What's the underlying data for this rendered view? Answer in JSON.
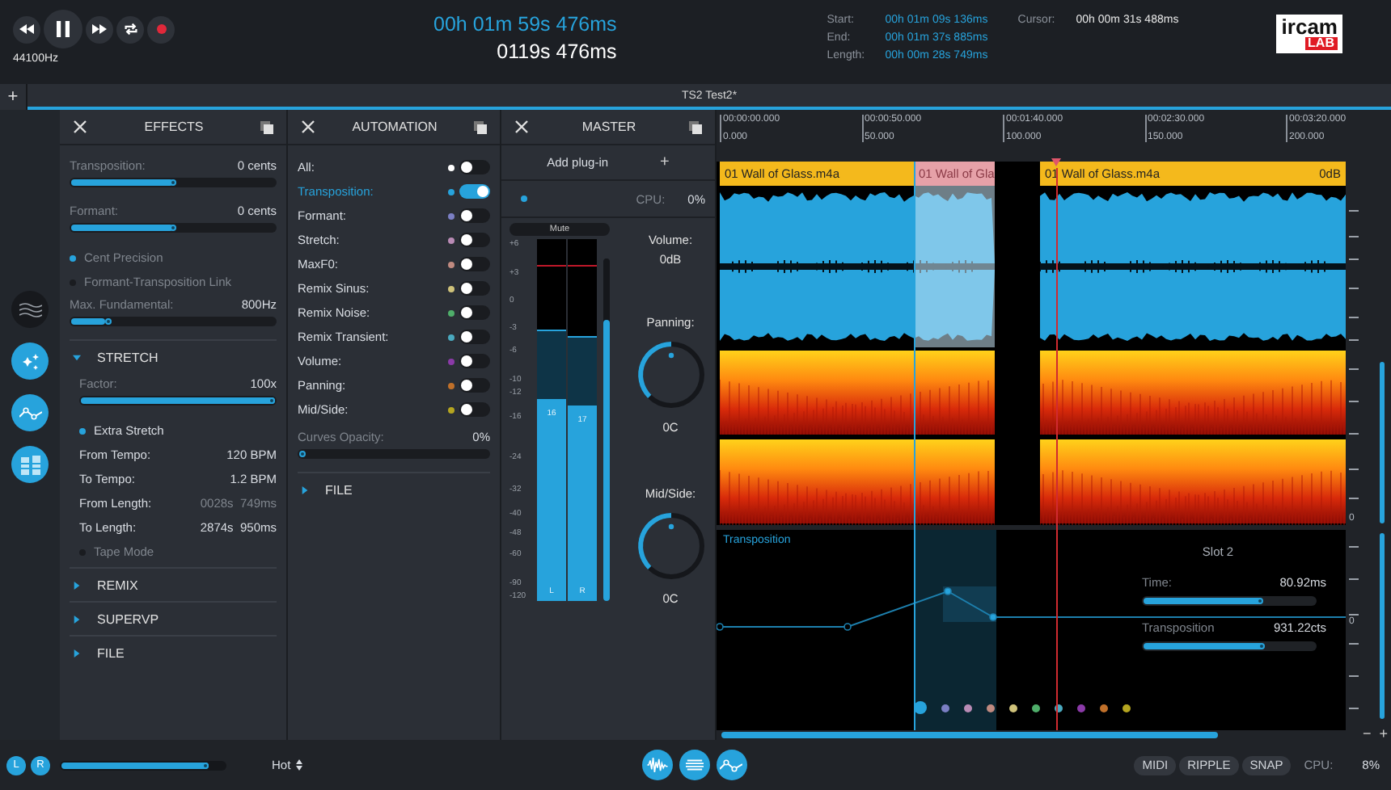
{
  "transport": {
    "buttons": [
      {
        "kind": "rewind"
      },
      {
        "kind": "pause"
      },
      {
        "kind": "forward"
      },
      {
        "kind": "loop"
      },
      {
        "kind": "record"
      }
    ],
    "sample_rate": "44100Hz"
  },
  "clock": {
    "time": "00h 01m 59s 476ms",
    "seconds": "0119s 476ms"
  },
  "selection": [
    {
      "label": "Start:",
      "value": "00h 01m 09s 136ms"
    },
    {
      "label": "End:",
      "value": "00h 01m 37s 885ms"
    },
    {
      "label": "Length:",
      "value": "00h 00m 28s 749ms"
    }
  ],
  "cursor": {
    "label": "Cursor:",
    "value": "00h 00m 31s 488ms"
  },
  "logo": {
    "top": "ircam",
    "bottom": "LAB"
  },
  "add_tab": "+",
  "tabs": [
    {
      "title": "TS2 Test2*",
      "selected": true
    }
  ],
  "rail": [
    {
      "kind": "waves",
      "selected": false
    },
    {
      "kind": "sparkle",
      "selected": true
    },
    {
      "kind": "curve",
      "selected": true
    },
    {
      "kind": "bars",
      "selected": true
    }
  ],
  "effects": {
    "title": "EFFECTS",
    "rows": [
      {
        "kind": "slider",
        "label": "Transposition:",
        "value": "0 cents",
        "level": 0.5
      },
      {
        "kind": "slider",
        "label": "Formant:",
        "value": "0 cents",
        "level": 0.5
      },
      {
        "kind": "option",
        "label": "Cent Precision",
        "checked": true,
        "disabled": true
      },
      {
        "kind": "option",
        "label": "Formant-Transposition Link",
        "checked": false,
        "disabled": true
      },
      {
        "kind": "slider",
        "label": "Max. Fundamental:",
        "value": "800Hz",
        "level": 0.17
      }
    ],
    "sections": [
      {
        "title": "STRETCH",
        "expanded": true,
        "rows": [
          {
            "kind": "slider",
            "label": "Factor:",
            "value": "100x",
            "level": 1
          },
          {
            "kind": "option",
            "label": "Extra Stretch",
            "checked": true,
            "disabled": false
          },
          {
            "kind": "pair",
            "label": "From Tempo:",
            "value": "120 BPM",
            "disabled": false
          },
          {
            "kind": "pair",
            "label": "To Tempo:",
            "value": "1.2 BPM",
            "disabled": false
          },
          {
            "kind": "pair",
            "label": "From Length:",
            "value": "0028s  749ms",
            "disabled": true
          },
          {
            "kind": "pair",
            "label": "To Length:",
            "value": "2874s  950ms",
            "disabled": false
          },
          {
            "kind": "option",
            "label": "Tape Mode",
            "checked": false,
            "disabled": true
          }
        ]
      },
      {
        "title": "REMIX",
        "expanded": false
      },
      {
        "title": "SUPERVP",
        "expanded": false
      },
      {
        "title": "FILE",
        "expanded": false
      }
    ]
  },
  "automation": {
    "title": "AUTOMATION",
    "items": [
      {
        "label": "All:",
        "color": "#ffffff",
        "on": false,
        "selected": false
      },
      {
        "label": "Transposition:",
        "color": "#27a3dc",
        "on": true,
        "selected": true
      },
      {
        "label": "Formant:",
        "color": "#7b7fc4",
        "on": false,
        "selected": false
      },
      {
        "label": "Stretch:",
        "color": "#b98bb5",
        "on": false,
        "selected": false
      },
      {
        "label": "MaxF0:",
        "color": "#c08a80",
        "on": false,
        "selected": false
      },
      {
        "label": "Remix Sinus:",
        "color": "#cfc27a",
        "on": false,
        "selected": false
      },
      {
        "label": "Remix Noise:",
        "color": "#4fae6a",
        "on": false,
        "selected": false
      },
      {
        "label": "Remix Transient:",
        "color": "#4aa9bf",
        "on": false,
        "selected": false
      },
      {
        "label": "Volume:",
        "color": "#8b3aa8",
        "on": false,
        "selected": false
      },
      {
        "label": "Panning:",
        "color": "#c0702a",
        "on": false,
        "selected": false
      },
      {
        "label": "Mid/Side:",
        "color": "#b5a520",
        "on": false,
        "selected": false
      }
    ],
    "opacity": {
      "label": "Curves Opacity:",
      "value": "0%",
      "level": 0
    },
    "sections": [
      {
        "title": "FILE",
        "expanded": false
      }
    ]
  },
  "master": {
    "title": "MASTER",
    "add_plugin": "Add plug-in",
    "add_icon": "+",
    "cpu": {
      "label": "CPU:",
      "value": "0%"
    },
    "mute": "Mute",
    "scale": [
      "+6",
      "+3",
      "0",
      "-3",
      "-6",
      "-10",
      "-12",
      "-16",
      "-24",
      "-32",
      "-40",
      "-48",
      "-60",
      "-90",
      "-120"
    ],
    "channels": [
      {
        "name": "L",
        "reading": "16",
        "level": 0.56
      },
      {
        "name": "R",
        "reading": "17",
        "level": 0.54
      }
    ],
    "fader": {
      "level": 0.82
    },
    "volume": {
      "label": "Volume:",
      "value": "0dB"
    },
    "knobs": [
      {
        "label": "Panning:",
        "value": "0C"
      },
      {
        "label": "Mid/Side:",
        "value": "0C"
      }
    ]
  },
  "editor": {
    "ruler": [
      {
        "time": "00:00:00.000",
        "seconds": "0.000"
      },
      {
        "time": "00:00:50.000",
        "seconds": "50.000"
      },
      {
        "time": "00:01:40.000",
        "seconds": "100.000"
      },
      {
        "time": "00:02:30.000",
        "seconds": "150.000"
      },
      {
        "time": "00:03:20.000",
        "seconds": "200.000"
      }
    ],
    "clips": [
      {
        "kind": "clip",
        "name": "01 Wall of Glass.m4a"
      },
      {
        "kind": "ghost",
        "name": "01 Wall of Gla"
      },
      {
        "kind": "clip",
        "name": "01 Wall of Glass.m4a",
        "gain": "0dB"
      }
    ],
    "lane": {
      "title": "Transposition",
      "slot": "Slot 2",
      "params": [
        {
          "label": "Time:",
          "value": "80.92ms",
          "level": 0.69
        },
        {
          "label": "Transposition",
          "value": "931.22cts",
          "level": 0.7
        }
      ],
      "curves": [
        {
          "color": "#27a3dc",
          "selected": true
        },
        {
          "color": "#7b7fc4",
          "selected": false
        },
        {
          "color": "#b98bb5",
          "selected": false
        },
        {
          "color": "#c08a80",
          "selected": false
        },
        {
          "color": "#cfc27a",
          "selected": false
        },
        {
          "color": "#4fae6a",
          "selected": false
        },
        {
          "color": "#4aa9bf",
          "selected": false
        },
        {
          "color": "#8b3aa8",
          "selected": false
        },
        {
          "color": "#c0702a",
          "selected": false
        },
        {
          "color": "#b5a520",
          "selected": false
        }
      ]
    },
    "scale_labels": [
      "0",
      "0"
    ],
    "zoom_out": "−",
    "zoom_in": "+"
  },
  "bottom": {
    "channels": [
      {
        "label": "L",
        "selected": true
      },
      {
        "label": "R",
        "selected": true
      }
    ],
    "level": 0.9,
    "mode": "Hot",
    "views": [
      {
        "kind": "waveform",
        "selected": true
      },
      {
        "kind": "spectrogram",
        "selected": true
      },
      {
        "kind": "curve",
        "selected": true
      }
    ],
    "toggles": [
      {
        "label": "MIDI",
        "on": false
      },
      {
        "label": "RIPPLE",
        "on": false
      },
      {
        "label": "SNAP",
        "on": false
      }
    ],
    "cpu": {
      "label": "CPU:",
      "value": "8%"
    }
  }
}
